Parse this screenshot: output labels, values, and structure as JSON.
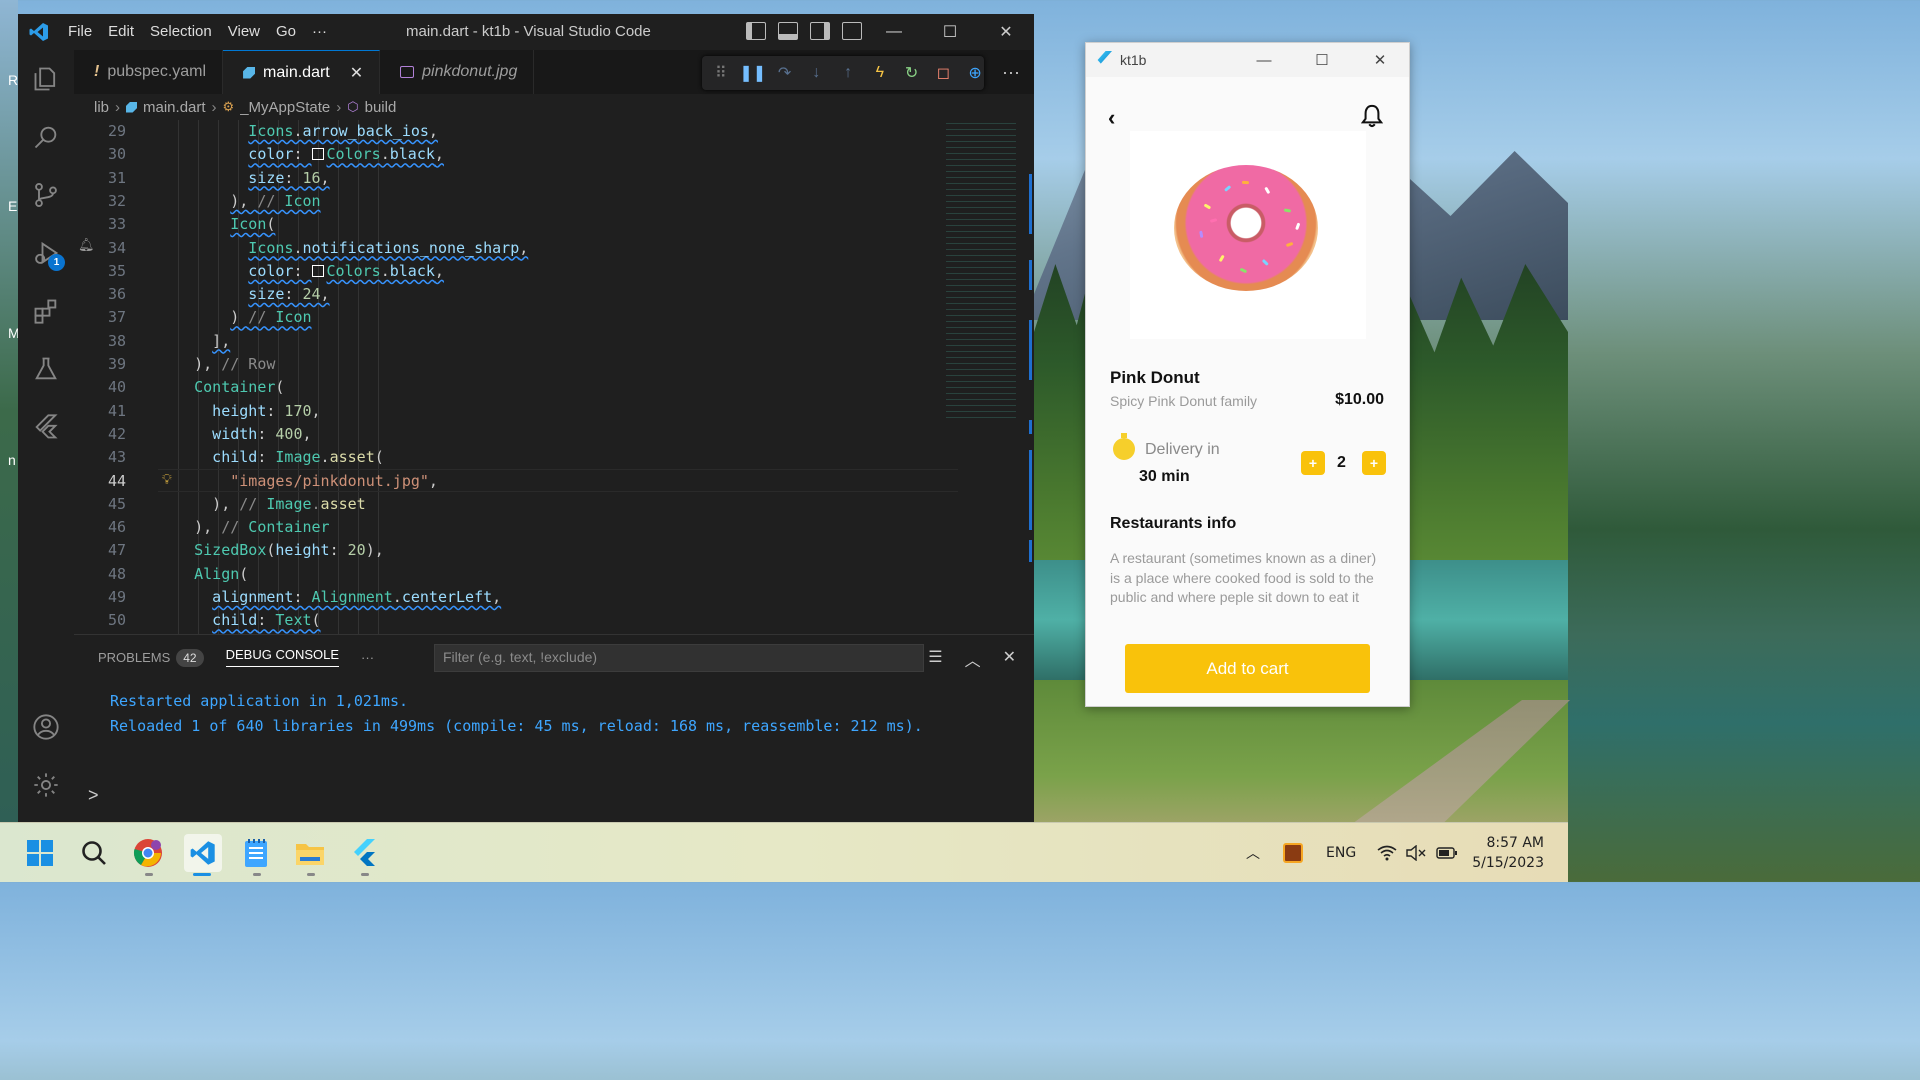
{
  "desktop": {
    "edge_letters": [
      "R",
      "E",
      "M",
      "n"
    ]
  },
  "vscode": {
    "menu": [
      "File",
      "Edit",
      "Selection",
      "View",
      "Go",
      "···"
    ],
    "window_title": "main.dart - kt1b - Visual Studio Code",
    "window_controls": [
      "—",
      "☐",
      "✕"
    ],
    "debug_badge": "1",
    "tabs": [
      {
        "label": "pubspec.yaml",
        "icon": "exclamation-icon"
      },
      {
        "label": "main.dart",
        "icon": "dart-icon",
        "active": true,
        "close": "✕"
      },
      {
        "label": "pinkdonut.jpg",
        "icon": "image-icon"
      }
    ],
    "more_actions": "···",
    "breadcrumb": [
      "lib",
      "main.dart",
      "_MyAppState",
      "build"
    ],
    "editor": {
      "lines": [
        {
          "n": "29",
          "text": "Icons.arrow_back_ios,"
        },
        {
          "n": "30",
          "text": "color: Colors.black,"
        },
        {
          "n": "31",
          "text": "size: 16,"
        },
        {
          "n": "32",
          "text": "), // Icon"
        },
        {
          "n": "33",
          "text": "Icon("
        },
        {
          "n": "34",
          "text": "Icons.notifications_none_sharp,"
        },
        {
          "n": "35",
          "text": "color: Colors.black,"
        },
        {
          "n": "36",
          "text": "size: 24,"
        },
        {
          "n": "37",
          "text": ") // Icon"
        },
        {
          "n": "38",
          "text": "],"
        },
        {
          "n": "39",
          "text": "), // Row"
        },
        {
          "n": "40",
          "text": "Container("
        },
        {
          "n": "41",
          "text": "height: 170,"
        },
        {
          "n": "42",
          "text": "width: 400,"
        },
        {
          "n": "43",
          "text": "child: Image.asset("
        },
        {
          "n": "44",
          "text": "\"images/pinkdonut.jpg\","
        },
        {
          "n": "45",
          "text": "), // Image.asset"
        },
        {
          "n": "46",
          "text": "), // Container"
        },
        {
          "n": "47",
          "text": "SizedBox(height: 20),"
        },
        {
          "n": "48",
          "text": "Align("
        },
        {
          "n": "49",
          "text": "alignment: Alignment.centerLeft,"
        },
        {
          "n": "50",
          "text": "child: Text("
        }
      ],
      "current_line": "44"
    },
    "panel": {
      "problems_label": "PROBLEMS",
      "problems_count": "42",
      "debug_console_label": "DEBUG CONSOLE",
      "more": "···",
      "filter_placeholder": "Filter (e.g. text, !exclude)",
      "console_lines": [
        "Restarted application in 1,021ms.",
        "Reloaded 1 of 640 libraries in 499ms (compile: 45 ms, reload: 168 ms, reassemble: 212 ms)."
      ],
      "prompt": ">"
    },
    "colors": {
      "accent": "#0078d4",
      "statusbar": "#c34c1e",
      "console_text": "#3ea6ff"
    }
  },
  "app": {
    "window_title": "kt1b",
    "window_controls": [
      "—",
      "☐",
      "✕"
    ],
    "product_name": "Pink Donut",
    "product_family": "Spicy Pink Donut family",
    "price": "$10.00",
    "delivery_label": "Delivery in",
    "delivery_time": "30 min",
    "quantity": "2",
    "minus_label": "+",
    "plus_label": "+",
    "restaurants_title": "Restaurants info",
    "restaurants_desc": "A restaurant (sometimes known as a diner) is a place where cooked food is sold to the public and where peple sit down to eat it",
    "add_to_cart": "Add to cart",
    "colors": {
      "accent": "#f9c20b",
      "donut": "#f06aa4"
    }
  },
  "taskbar": {
    "apps": [
      "windows-start-icon",
      "search-icon",
      "chrome-icon",
      "vscode-icon",
      "notepad-icon",
      "file-explorer-icon",
      "flutter-icon"
    ],
    "language": "ENG",
    "time": "8:57 AM",
    "date": "5/15/2023"
  }
}
